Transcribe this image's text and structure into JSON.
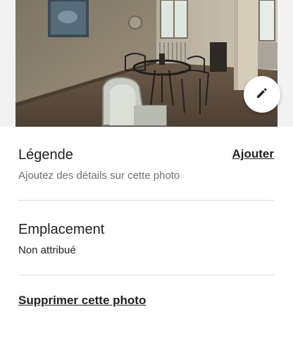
{
  "photo": {
    "alt_subject": "interior room with wrought-iron table and chairs",
    "edit_icon": "pencil-icon"
  },
  "caption": {
    "title": "Légende",
    "placeholder": "Ajoutez des détails sur cette photo",
    "action_label": "Ajouter"
  },
  "location": {
    "title": "Emplacement",
    "value": "Non attribué"
  },
  "actions": {
    "delete_label": "Supprimer cette photo"
  },
  "colors": {
    "text": "#222222",
    "muted": "#717171",
    "divider": "#dddddd",
    "background": "#ffffff"
  }
}
